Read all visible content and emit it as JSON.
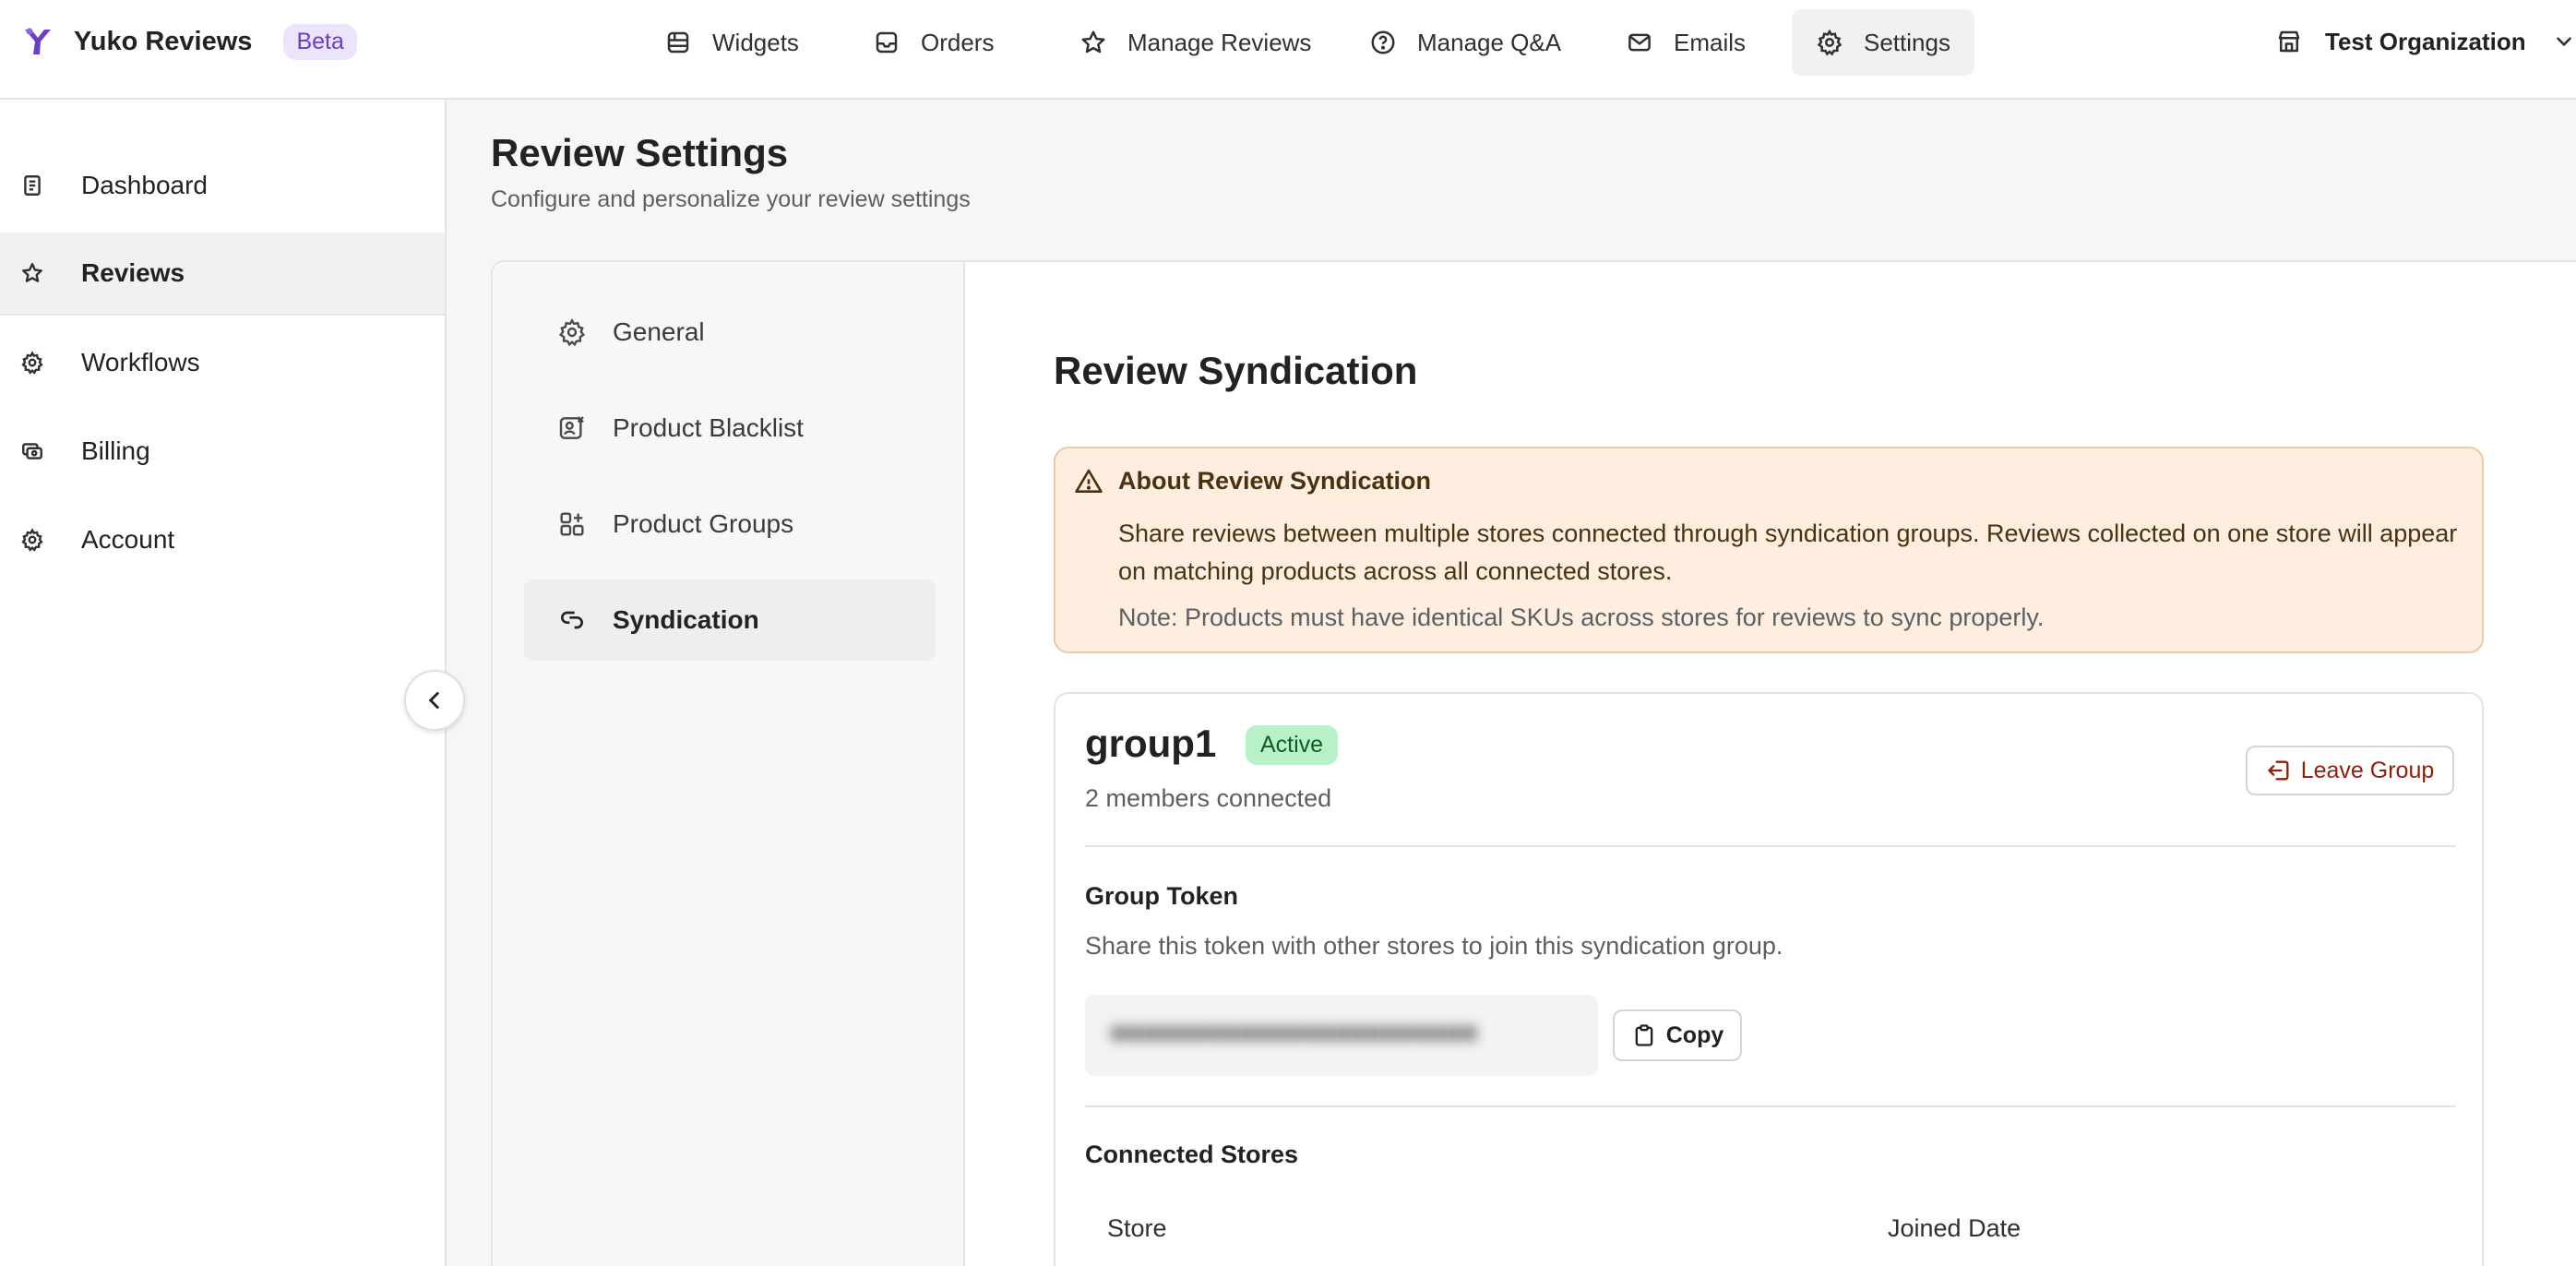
{
  "brand": {
    "name": "Yuko Reviews",
    "badge": "Beta",
    "accent": "#6a3fc8"
  },
  "topnav": [
    {
      "label": "Widgets",
      "icon": "widgets-icon"
    },
    {
      "label": "Orders",
      "icon": "inbox-icon"
    },
    {
      "label": "Manage Reviews",
      "icon": "star-icon"
    },
    {
      "label": "Manage Q&A",
      "icon": "question-icon"
    },
    {
      "label": "Emails",
      "icon": "mail-icon"
    },
    {
      "label": "Settings",
      "icon": "gear-icon",
      "active": true
    }
  ],
  "organization": {
    "label": "Test Organization"
  },
  "sidebar": {
    "items": [
      {
        "label": "Dashboard",
        "icon": "document-icon"
      },
      {
        "label": "Reviews",
        "icon": "star-icon",
        "active": true
      },
      {
        "label": "Workflows",
        "icon": "gear-icon"
      },
      {
        "label": "Billing",
        "icon": "billing-icon"
      },
      {
        "label": "Account",
        "icon": "gear-icon"
      }
    ]
  },
  "page": {
    "title": "Review Settings",
    "subtitle": "Configure and personalize your review settings"
  },
  "settings_nav": [
    {
      "label": "General",
      "icon": "gear-icon"
    },
    {
      "label": "Product Blacklist",
      "icon": "blacklist-icon"
    },
    {
      "label": "Product Groups",
      "icon": "groups-icon"
    },
    {
      "label": "Syndication",
      "icon": "link-icon",
      "active": true
    }
  ],
  "content": {
    "title": "Review Syndication",
    "alert": {
      "title": "About Review Syndication",
      "body": "Share reviews between multiple stores connected through syndication groups. Reviews collected on one store will appear on matching products across all connected stores.",
      "note": "Note: Products must have identical SKUs across stores for reviews to sync properly.",
      "background": "#fdeee0"
    },
    "group": {
      "name": "group1",
      "status": "Active",
      "members": "2 members connected",
      "leave_label": "Leave Group",
      "token_title": "Group Token",
      "token_desc": "Share this token with other stores to join this syndication group.",
      "copy_label": "Copy",
      "connected_title": "Connected Stores",
      "columns": [
        "Store",
        "Joined Date"
      ]
    }
  }
}
